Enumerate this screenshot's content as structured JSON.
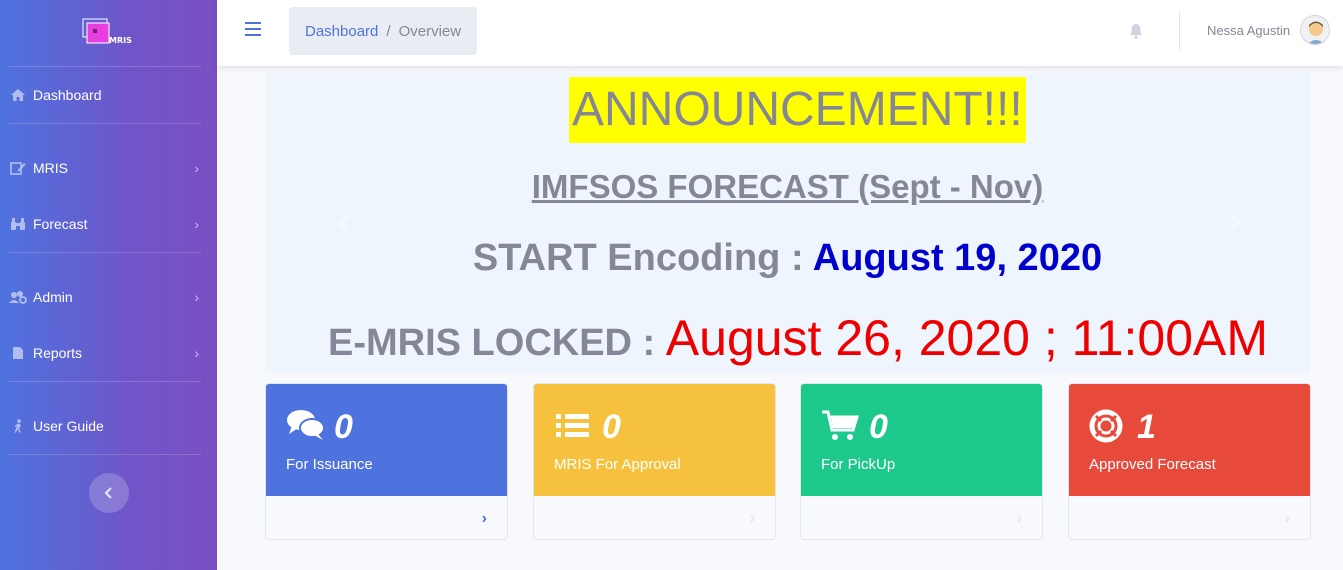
{
  "sidebar": {
    "brand_text": "MRIS",
    "items": [
      {
        "label": "Dashboard",
        "icon": "home-icon"
      },
      {
        "label": "MRIS",
        "icon": "edit-icon"
      },
      {
        "label": "Forecast",
        "icon": "binoculars-icon"
      },
      {
        "label": "Admin",
        "icon": "users-cog-icon"
      },
      {
        "label": "Reports",
        "icon": "file-icon"
      },
      {
        "label": "User Guide",
        "icon": "walking-icon"
      }
    ],
    "toggle_icon": "chevron-left-icon"
  },
  "topbar": {
    "breadcrumb": {
      "link": "Dashboard",
      "separator": "/",
      "current": "Overview"
    },
    "user_name": "Nessa Agustin",
    "notification_icon": "bell-icon"
  },
  "announcement": {
    "title": "ANNOUNCEMENT!!!",
    "subtitle": "IMFSOS FORECAST (Sept - Nov)",
    "start_label": "START Encoding",
    "start_sep": " : ",
    "start_date": "August 19, 2020",
    "locked_label": "E-MRIS LOCKED",
    "locked_sep": " : ",
    "locked_date": "August 26, 2020 ; 11:00AM"
  },
  "cards": [
    {
      "count": "0",
      "label": "For Issuance",
      "icon": "comments-icon",
      "color": "#4e73df"
    },
    {
      "count": "0",
      "label": "MRIS For Approval",
      "icon": "list-icon",
      "color": "#f6c23e"
    },
    {
      "count": "0",
      "label": "For PickUp",
      "icon": "cart-icon",
      "color": "#1cc88a"
    },
    {
      "count": "1",
      "label": "Approved Forecast",
      "icon": "life-ring-icon",
      "color": "#e74a3b"
    }
  ],
  "card_arrow": "›"
}
